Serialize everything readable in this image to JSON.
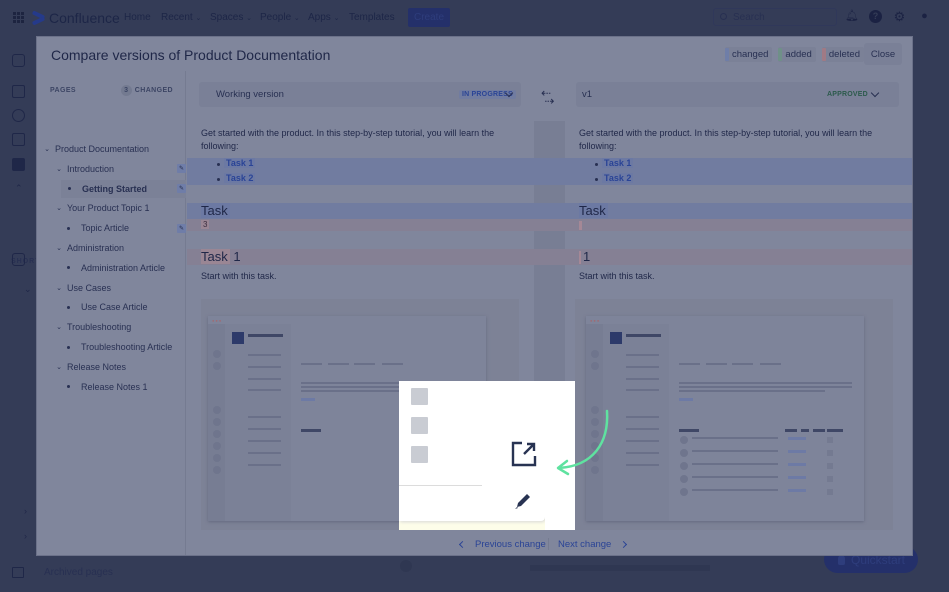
{
  "app": {
    "name": "Confluence",
    "nav": [
      "Home",
      "Recent",
      "Spaces",
      "People",
      "Apps",
      "Templates"
    ],
    "create_label": "Create",
    "search_placeholder": "Search",
    "sidebar_section": "SHORTCUTS",
    "archived_label": "Archived pages",
    "quickstart_label": "Quickstart"
  },
  "modal": {
    "title": "Compare versions of Product Documentation",
    "legend": [
      {
        "label": "changed",
        "color": "#6f7ea8"
      },
      {
        "label": "added",
        "color": "#6f9088"
      },
      {
        "label": "deleted",
        "color": "#a07a85"
      }
    ],
    "close_label": "Close"
  },
  "pages": {
    "header": "PAGES",
    "changed_count": "3",
    "changed_label": "CHANGED",
    "tree": [
      {
        "label": "Product Documentation",
        "level": 0,
        "type": "parent",
        "edited": false,
        "active": false
      },
      {
        "label": "Introduction",
        "level": 1,
        "type": "parent",
        "edited": true,
        "active": false
      },
      {
        "label": "Getting Started",
        "level": 2,
        "type": "leaf",
        "edited": true,
        "active": true
      },
      {
        "label": "Your Product Topic 1",
        "level": 1,
        "type": "parent",
        "edited": false,
        "active": false
      },
      {
        "label": "Topic Article",
        "level": 2,
        "type": "leaf",
        "edited": true,
        "active": false
      },
      {
        "label": "Administration",
        "level": 1,
        "type": "parent",
        "edited": false,
        "active": false
      },
      {
        "label": "Administration Article",
        "level": 2,
        "type": "leaf",
        "edited": false,
        "active": false
      },
      {
        "label": "Use Cases",
        "level": 1,
        "type": "parent",
        "edited": false,
        "active": false
      },
      {
        "label": "Use Case Article",
        "level": 2,
        "type": "leaf",
        "edited": false,
        "active": false
      },
      {
        "label": "Troubleshooting",
        "level": 1,
        "type": "parent",
        "edited": false,
        "active": false
      },
      {
        "label": "Troubleshooting Article",
        "level": 2,
        "type": "leaf",
        "edited": false,
        "active": false
      },
      {
        "label": "Release Notes",
        "level": 1,
        "type": "parent",
        "edited": false,
        "active": false
      },
      {
        "label": "Release Notes 1",
        "level": 2,
        "type": "leaf",
        "edited": false,
        "active": false
      }
    ]
  },
  "versions": {
    "left": {
      "name": "Working version",
      "status": "IN PROGRESS",
      "status_color": "#2a4496",
      "status_bg": "#717ca0"
    },
    "right": {
      "name": "v1",
      "status": "APPROVED",
      "status_color": "#2c5a4c",
      "status_bg": "#7a8097"
    }
  },
  "diff": {
    "intro": "Get started with the product. In this step-by-step tutorial, you will learn the following:",
    "tasks": [
      "Task 1",
      "Task 2"
    ],
    "left_heading_1": "Task",
    "left_deleted_1": "3",
    "left_heading_2_highlight": "Task",
    "left_heading_2_rest": " 1",
    "right_heading_1": "Task",
    "right_heading_2": "1",
    "body": "Start with this task.",
    "thumb_url": "https://example.com"
  },
  "footer": {
    "prev_label": "Previous change",
    "next_label": "Next change"
  }
}
